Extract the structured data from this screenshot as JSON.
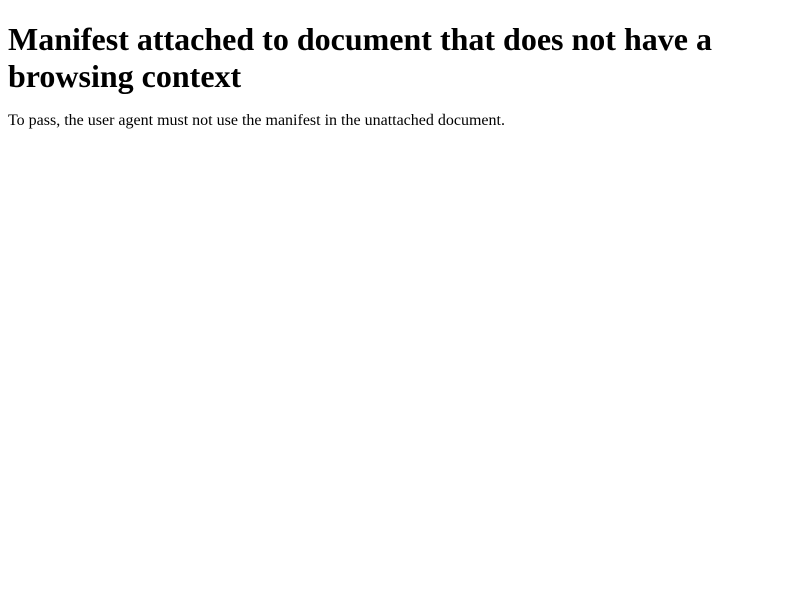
{
  "page": {
    "heading": "Manifest attached to document that does not have a browsing context",
    "description": "To pass, the user agent must not use the manifest in the unattached document."
  }
}
